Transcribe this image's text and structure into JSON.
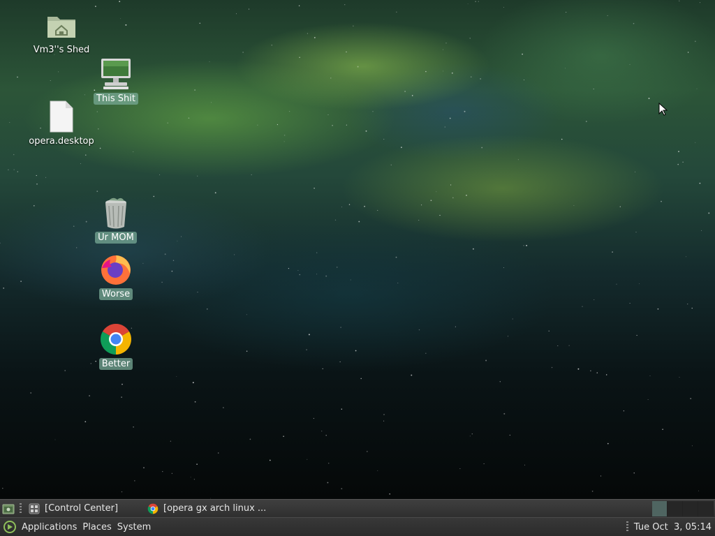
{
  "desktop": {
    "icons": [
      {
        "label": "Vm3''s Shed",
        "icon": "home-folder-icon",
        "selected": false
      },
      {
        "label": "This Shit",
        "icon": "computer-icon",
        "selected": true
      },
      {
        "label": "opera.desktop",
        "icon": "document-icon",
        "selected": false
      },
      {
        "label": "Ur MOM",
        "icon": "trash-icon",
        "selected": true
      },
      {
        "label": "Worse",
        "icon": "firefox-icon",
        "selected": true
      },
      {
        "label": "Better",
        "icon": "chrome-icon",
        "selected": true
      }
    ]
  },
  "taskbar_top": {
    "tasks": [
      {
        "label": "[Control Center]",
        "icon": "control-center-icon"
      },
      {
        "label": "[opera gx arch linux ...",
        "icon": "chrome-icon"
      }
    ],
    "show_desktop_icon": "show-desktop-icon",
    "workspace_count": 4,
    "active_workspace": 1
  },
  "taskbar_bottom": {
    "menu": {
      "applications": "Applications",
      "places": "Places",
      "system": "System"
    },
    "clock": "Tue Oct  3, 05:14"
  },
  "colors": {
    "panel": "#333333",
    "selection": "#78aa96",
    "active_workspace": "#4f6561"
  }
}
